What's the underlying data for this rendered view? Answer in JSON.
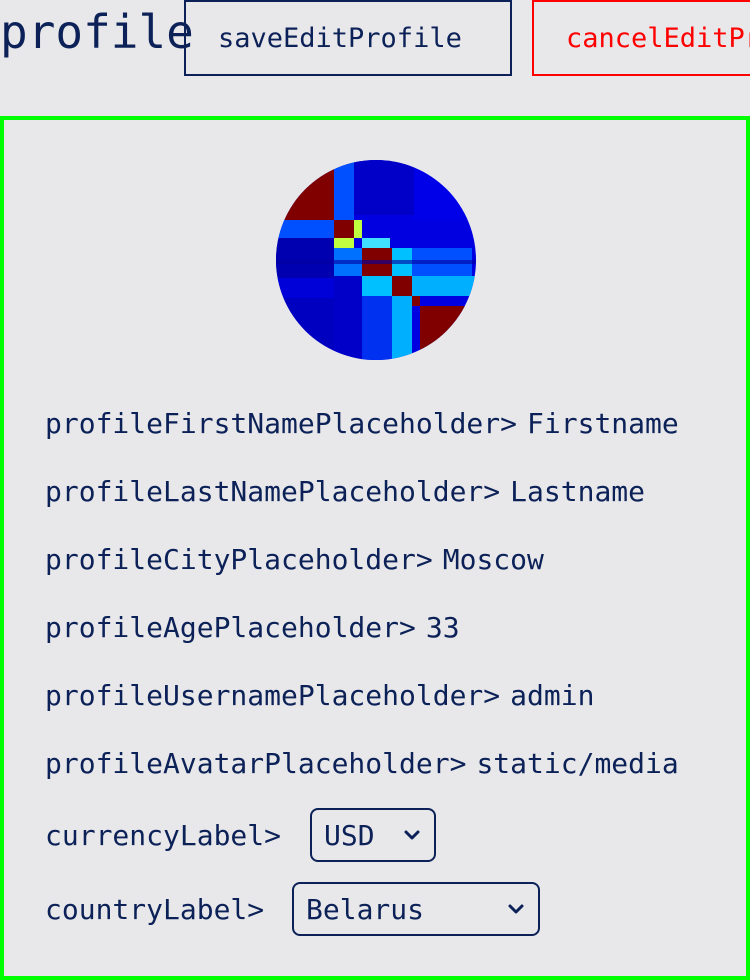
{
  "header": {
    "title": "profile",
    "save_label": "saveEditProfile",
    "cancel_label": "cancelEditProfile"
  },
  "colors": {
    "text": "#0b2157",
    "cancel": "#ff0000",
    "card_border": "#00ff00",
    "background": "#e8e8ea"
  },
  "avatar": {
    "icon": "avatar-image"
  },
  "fields": [
    {
      "label": "profileFirstNamePlaceholder>",
      "value": "Firstname"
    },
    {
      "label": "profileLastNamePlaceholder>",
      "value": "Lastname"
    },
    {
      "label": "profileCityPlaceholder>",
      "value": "Moscow"
    },
    {
      "label": "profileAgePlaceholder>",
      "value": "33"
    },
    {
      "label": "profileUsernamePlaceholder>",
      "value": "admin"
    },
    {
      "label": "profileAvatarPlaceholder>",
      "value": "static/media"
    }
  ],
  "currency": {
    "label": "currencyLabel>",
    "selected": "USD"
  },
  "country": {
    "label": "countryLabel>",
    "selected": "Belarus"
  }
}
